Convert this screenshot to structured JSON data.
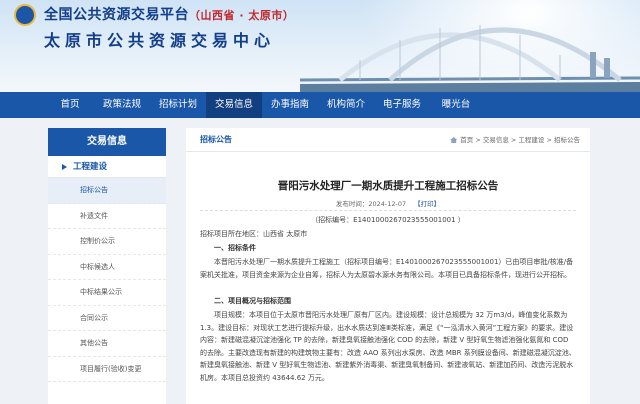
{
  "header": {
    "title_main": "全国公共资源交易平台",
    "title_region": "（山西省 · 太原市）",
    "title_center": "太原市公共资源交易中心"
  },
  "nav": {
    "items": [
      "首页",
      "政策法规",
      "招标计划",
      "交易信息",
      "办事指南",
      "机构简介",
      "电子服务",
      "曝光台"
    ],
    "active_index": 3
  },
  "sidebar": {
    "heading": "交易信息",
    "category": "工程建设",
    "items": [
      "招标公告",
      "补遗文件",
      "控制价公示",
      "中标候选人",
      "中标结果公示",
      "合同公示",
      "其他公告",
      "项目履行(验收)变更"
    ],
    "active_index": 0
  },
  "main": {
    "section_title": "招标公告",
    "breadcrumb": "首页 > 交易信息 > 工程建设 > 招标公告",
    "article": {
      "title": "晋阳污水处理厂一期水质提升工程施工招标公告",
      "meta_label": "发布时间：",
      "date": "2024-12-07",
      "print_label": "【打印】",
      "number_line": "（招标编号：E1401000267023555001001 ）",
      "location_line": "招标项目所在地区：山西省 太原市",
      "heading_1": "一、招标条件",
      "para_1": "本晋阳污水处理厂一期水质提升工程施工（招标项目编号：E1401000267023555001001）已由项目审批/核准/备案机关批准，项目资金来源为企业自筹，招标人为太原碧水源水务有限公司。本项目已具备招标条件，现进行公开招标。",
      "heading_2": "二、项目概况与招标范围",
      "para_2": "项目规模：本项目位于太原市晋阳污水处理厂原有厂区内。建设规模：设计总规模为 32 万m3/d，峰值变化系数为 1.3。建设目标：对现状工艺进行提标升级，出水水质达到准Ⅲ类标准，满足《“一泓清水入黄河”工程方案》的要求。建设内容：新建磁混凝沉淀池强化 TP 的去除，新建臭氧接触池强化 COD 的去除，新建 V 型好氧生物滤池强化氨氮和 COD 的去除。主要改造现有新建的构建筑物主要有：改造 AAO 系列出水泵房、改造 MBR 系列膜设备间、新建磁混凝沉淀池、新建臭氧接触池、新建 V 型好氧生物滤池、新建紫外消毒渠、新建臭氧制备间、新建液氧站、新建加药间、改造污泥脱水机房。本项目总投资约 43644.62 万元。"
    }
  }
}
